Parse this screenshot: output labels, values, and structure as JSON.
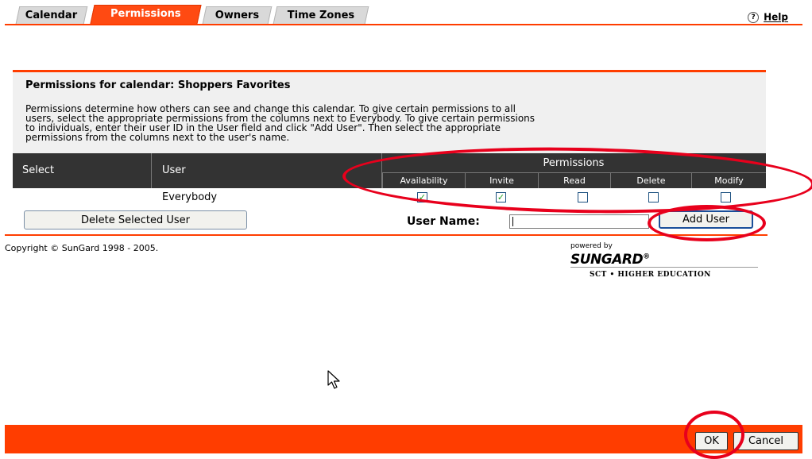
{
  "tabs": [
    {
      "label": "Calendar",
      "active": false
    },
    {
      "label": "Permissions",
      "active": true
    },
    {
      "label": "Owners",
      "active": false
    },
    {
      "label": "Time Zones",
      "active": false
    }
  ],
  "help": {
    "label": "Help",
    "icon": "question-circle-icon"
  },
  "panel": {
    "title": "Permissions for calendar: Shoppers Favorites",
    "description_lines": [
      "Permissions determine how others can see and change this calendar. To give certain permissions to all",
      "users, select the appropriate permissions from the columns next to Everybody. To give certain permissions",
      "to individuals, enter their user ID in the User field and click \"Add User\". Then select the appropriate",
      "permissions from the columns next to the user's name."
    ]
  },
  "table": {
    "col_select": "Select",
    "col_user": "User",
    "permissions_header": "Permissions",
    "permission_columns": [
      "Availability",
      "Invite",
      "Read",
      "Delete",
      "Modify"
    ],
    "rows": [
      {
        "user": "Everybody",
        "checked": [
          true,
          true,
          false,
          false,
          false
        ]
      }
    ]
  },
  "actions": {
    "delete_button": "Delete Selected User",
    "username_label": "User Name:",
    "username_value": "",
    "add_button": "Add User"
  },
  "footer": {
    "copyright": "Copyright © SunGard 1998 - 2005.",
    "powered_by": "powered by",
    "brand": "SUNGARD",
    "brand_mark": "®",
    "tagline": "SCT • HIGHER EDUCATION"
  },
  "bottom": {
    "ok": "OK",
    "cancel": "Cancel"
  },
  "colors": {
    "accent": "#ff3d00",
    "annotation": "#e8001c",
    "header_dark": "#333333"
  }
}
